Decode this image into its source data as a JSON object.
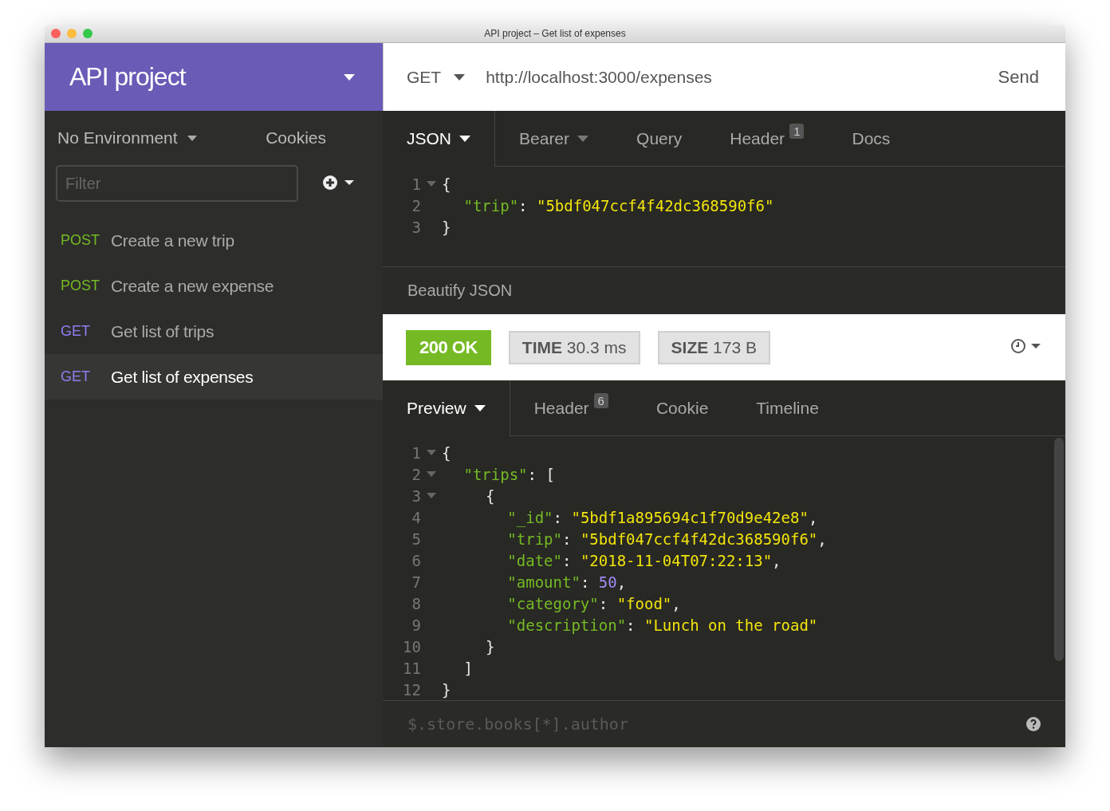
{
  "window": {
    "title": "API project – Get list of expenses"
  },
  "sidebar": {
    "workspace": "API project",
    "environment": "No Environment",
    "cookies": "Cookies",
    "filter": {
      "placeholder": "Filter"
    },
    "items": [
      {
        "method": "POST",
        "kind": "post",
        "name": "Create a new trip",
        "selected": false
      },
      {
        "method": "POST",
        "kind": "post",
        "name": "Create a new expense",
        "selected": false
      },
      {
        "method": "GET",
        "kind": "get",
        "name": "Get list of trips",
        "selected": false
      },
      {
        "method": "GET",
        "kind": "get",
        "name": "Get list of expenses",
        "selected": true
      }
    ]
  },
  "request": {
    "method": "GET",
    "url": "http://localhost:3000/expenses",
    "send": "Send",
    "tabs": [
      {
        "label": "JSON",
        "selected": true,
        "dropdown": true
      },
      {
        "label": "Bearer",
        "selected": false,
        "dropdown": true
      },
      {
        "label": "Query",
        "selected": false,
        "dropdown": false
      },
      {
        "label": "Header",
        "selected": false,
        "dropdown": false,
        "badge": "1"
      },
      {
        "label": "Docs",
        "selected": false,
        "dropdown": false
      }
    ],
    "body": [
      {
        "number": "1",
        "fold": true,
        "tokens": [
          {
            "kind": "punct",
            "text": "{"
          }
        ],
        "children": [
          {
            "number": "2",
            "fold": false,
            "tokens": [
              {
                "kind": "key",
                "text": "\"trip\""
              },
              {
                "kind": "punct",
                "text": ": "
              },
              {
                "kind": "string",
                "text": "\"5bdf047ccf4f42dc368590f6\""
              }
            ]
          }
        ]
      },
      {
        "number": "3",
        "fold": false,
        "tokens": [
          {
            "kind": "punct",
            "text": "}"
          }
        ]
      }
    ],
    "beautify": "Beautify JSON"
  },
  "response": {
    "status": {
      "text": "200 OK",
      "kind": "success"
    },
    "time": {
      "label": "TIME",
      "value": "30.3 ms"
    },
    "size": {
      "label": "SIZE",
      "value": "173 B"
    },
    "tabs": [
      {
        "label": "Preview",
        "selected": true,
        "dropdown": true
      },
      {
        "label": "Header",
        "selected": false,
        "dropdown": false,
        "badge": "6"
      },
      {
        "label": "Cookie",
        "selected": false,
        "dropdown": false
      },
      {
        "label": "Timeline",
        "selected": false,
        "dropdown": false
      }
    ],
    "body": [
      {
        "number": "1",
        "fold": true,
        "tokens": [
          {
            "kind": "punct",
            "text": "{"
          }
        ],
        "children": [
          {
            "number": "2",
            "fold": true,
            "tokens": [
              {
                "kind": "key",
                "text": "\"trips\""
              },
              {
                "kind": "punct",
                "text": ": ["
              }
            ],
            "children": [
              {
                "number": "3",
                "fold": true,
                "tokens": [
                  {
                    "kind": "punct",
                    "text": "{"
                  }
                ],
                "children": [
                  {
                    "number": "4",
                    "fold": false,
                    "tokens": [
                      {
                        "kind": "key",
                        "text": "\"_id\""
                      },
                      {
                        "kind": "punct",
                        "text": ": "
                      },
                      {
                        "kind": "string",
                        "text": "\"5bdf1a895694c1f70d9e42e8\""
                      },
                      {
                        "kind": "punct",
                        "text": ","
                      }
                    ]
                  },
                  {
                    "number": "5",
                    "fold": false,
                    "tokens": [
                      {
                        "kind": "key",
                        "text": "\"trip\""
                      },
                      {
                        "kind": "punct",
                        "text": ": "
                      },
                      {
                        "kind": "string",
                        "text": "\"5bdf047ccf4f42dc368590f6\""
                      },
                      {
                        "kind": "punct",
                        "text": ","
                      }
                    ]
                  },
                  {
                    "number": "6",
                    "fold": false,
                    "tokens": [
                      {
                        "kind": "key",
                        "text": "\"date\""
                      },
                      {
                        "kind": "punct",
                        "text": ": "
                      },
                      {
                        "kind": "string",
                        "text": "\"2018-11-04T07:22:13\""
                      },
                      {
                        "kind": "punct",
                        "text": ","
                      }
                    ]
                  },
                  {
                    "number": "7",
                    "fold": false,
                    "tokens": [
                      {
                        "kind": "key",
                        "text": "\"amount\""
                      },
                      {
                        "kind": "punct",
                        "text": ": "
                      },
                      {
                        "kind": "number",
                        "text": "50"
                      },
                      {
                        "kind": "punct",
                        "text": ","
                      }
                    ]
                  },
                  {
                    "number": "8",
                    "fold": false,
                    "tokens": [
                      {
                        "kind": "key",
                        "text": "\"category\""
                      },
                      {
                        "kind": "punct",
                        "text": ": "
                      },
                      {
                        "kind": "string",
                        "text": "\"food\""
                      },
                      {
                        "kind": "punct",
                        "text": ","
                      }
                    ]
                  },
                  {
                    "number": "9",
                    "fold": false,
                    "tokens": [
                      {
                        "kind": "key",
                        "text": "\"description\""
                      },
                      {
                        "kind": "punct",
                        "text": ": "
                      },
                      {
                        "kind": "string",
                        "text": "\"Lunch on the road\""
                      }
                    ]
                  }
                ]
              },
              {
                "number": "10",
                "fold": false,
                "tokens": [
                  {
                    "kind": "punct",
                    "text": "}"
                  }
                ]
              }
            ]
          },
          {
            "number": "11",
            "fold": false,
            "tokens": [
              {
                "kind": "punct",
                "text": "]"
              }
            ]
          }
        ]
      },
      {
        "number": "12",
        "fold": false,
        "tokens": [
          {
            "kind": "punct",
            "text": "}"
          }
        ]
      }
    ],
    "filter": {
      "placeholder": "$.store.books[*].author"
    }
  }
}
